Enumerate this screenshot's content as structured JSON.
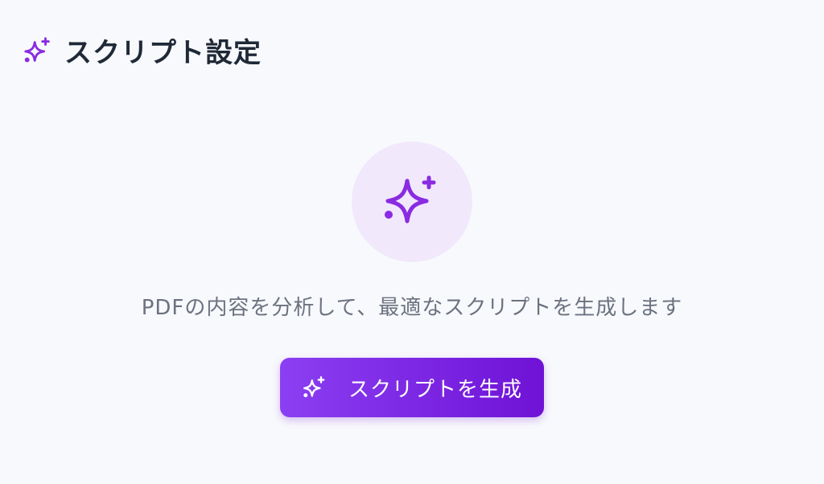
{
  "header": {
    "title": "スクリプト設定",
    "icon": "sparkles-icon"
  },
  "main": {
    "hero_icon": "sparkles-icon",
    "description": "PDFの内容を分析して、最適なスクリプトを生成します",
    "generate_button": {
      "label": "スクリプトを生成",
      "icon": "sparkles-icon"
    }
  },
  "colors": {
    "accent": "#8a2be2",
    "button_gradient_start": "#8b3ff2",
    "button_gradient_end": "#6f12d6",
    "hero_circle_bg": "#f1e8fc",
    "page_bg": "#f8f9fc",
    "title_text": "#1f2937",
    "description_text": "#6b7280"
  }
}
